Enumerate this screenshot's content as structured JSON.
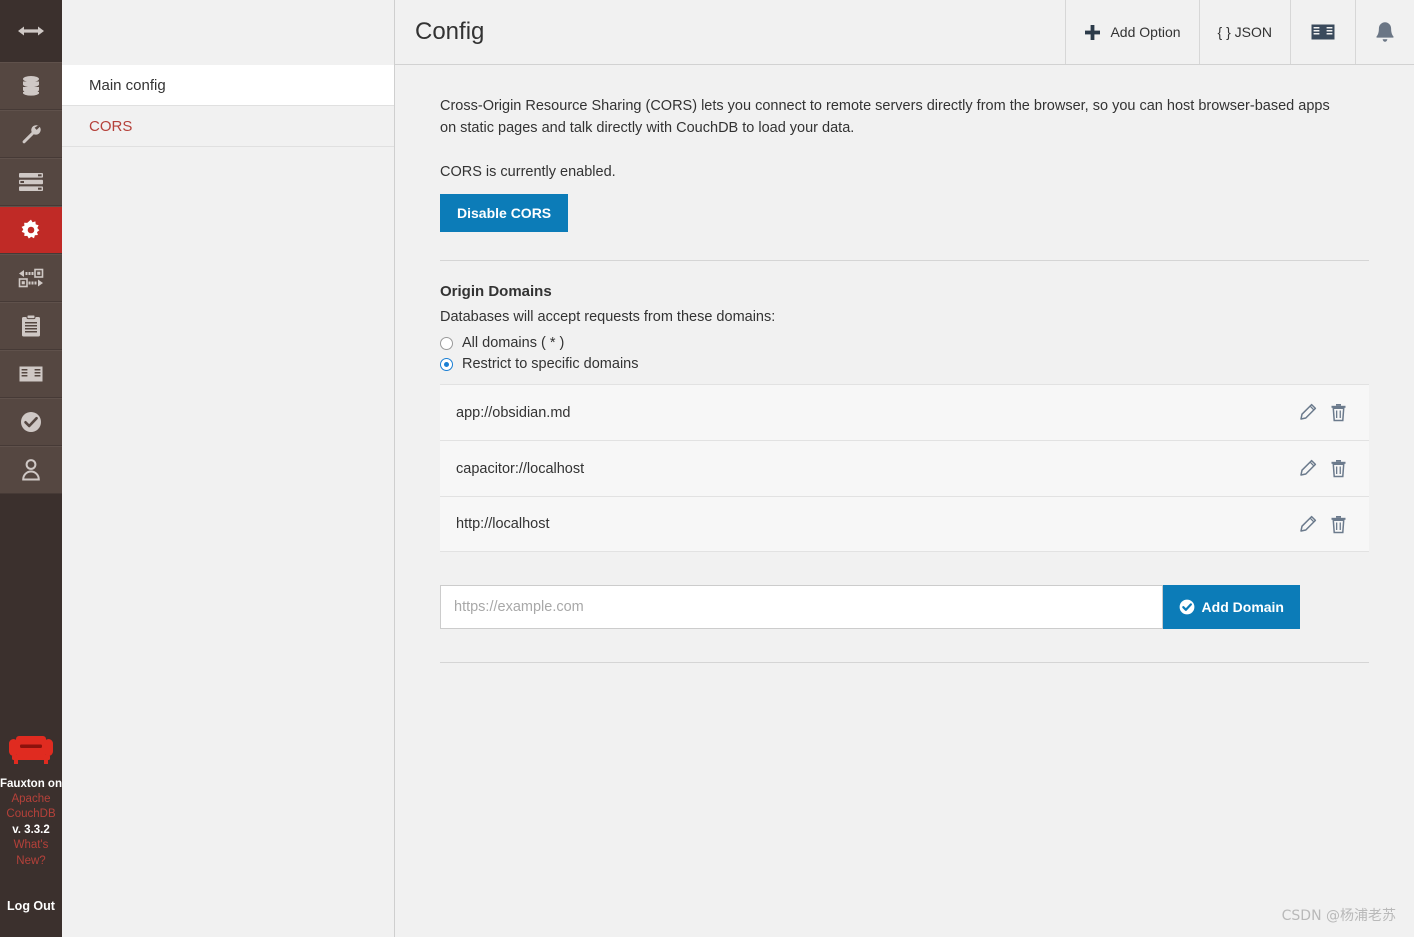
{
  "rail": {
    "toggle": {
      "name": "expand-collapse-toggle"
    },
    "items": [
      {
        "icon": "database-icon",
        "label": "Databases",
        "active": false
      },
      {
        "icon": "wrench-icon",
        "label": "Setup",
        "active": false
      },
      {
        "icon": "server-bars-icon",
        "label": "Cluster Setup",
        "active": false
      },
      {
        "icon": "gear-icon",
        "label": "Configuration",
        "active": true
      },
      {
        "icon": "replication-icon",
        "label": "Replication",
        "active": false
      },
      {
        "icon": "clipboard-icon",
        "label": "Active Tasks",
        "active": false
      },
      {
        "icon": "book-icon",
        "label": "Documentation",
        "active": false
      },
      {
        "icon": "check-circle-icon",
        "label": "Verify",
        "active": false
      },
      {
        "icon": "user-icon",
        "label": "Account",
        "active": false
      }
    ],
    "footer": {
      "logo": "couch-logo",
      "fauxton_on": "Fauxton on",
      "product_line1": "Apache",
      "product_line2": "CouchDB",
      "version": "v. 3.3.2",
      "whats_new_line1": "What's",
      "whats_new_line2": "New?",
      "logout": "Log Out"
    }
  },
  "subnav": {
    "items": [
      {
        "label": "Main config",
        "active": false
      },
      {
        "label": "CORS",
        "active": true
      }
    ]
  },
  "topbar": {
    "title": "Config",
    "actions": [
      {
        "name": "add-option-button",
        "icon": "plus-icon",
        "label": "Add Option"
      },
      {
        "name": "json-button",
        "icon": "braces-icon",
        "label": "{ } JSON"
      },
      {
        "name": "documentation-button",
        "icon": "book-icon",
        "label": ""
      },
      {
        "name": "notifications-button",
        "icon": "bell-icon",
        "label": ""
      }
    ]
  },
  "cors": {
    "blurb": "Cross-Origin Resource Sharing (CORS) lets you connect to remote servers directly from the browser, so you can host browser-based apps on static pages and talk directly with CouchDB to load your data.",
    "status": "CORS is currently enabled.",
    "toggle_button": "Disable CORS",
    "section_title": "Origin Domains",
    "section_subtitle": "Databases will accept requests from these domains:",
    "options": [
      {
        "label": "All domains ( * )",
        "selected": false
      },
      {
        "label": "Restrict to specific domains",
        "selected": true
      }
    ],
    "domains": [
      {
        "name": "app://obsidian.md"
      },
      {
        "name": "capacitor://localhost"
      },
      {
        "name": "http://localhost"
      }
    ],
    "add_placeholder": "https://example.com",
    "add_value": "",
    "add_button": "Add Domain"
  },
  "watermark": "CSDN @杨浦老苏",
  "colors": {
    "accent_blue": "#0c7cb8",
    "brand_red": "#b5413a",
    "active_red": "#c02a26",
    "rail_dark": "#3b302d",
    "rail_item": "#554741",
    "radio_blue": "#1a7fd4"
  }
}
